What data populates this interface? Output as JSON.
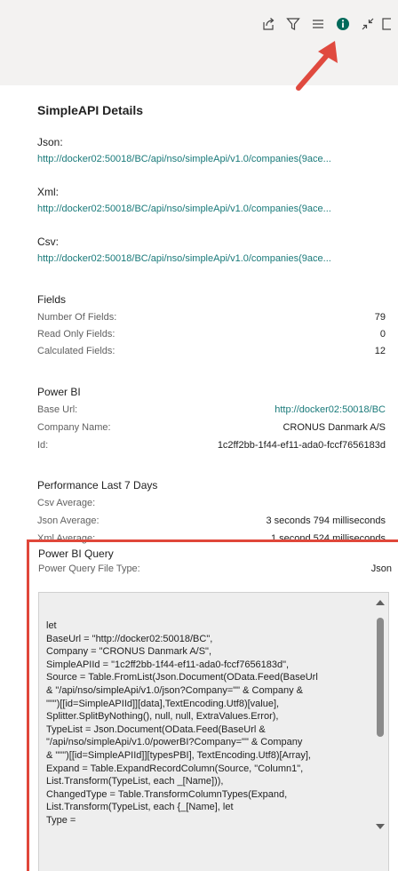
{
  "panel": {
    "title": "SimpleAPI Details"
  },
  "json": {
    "label": "Json:",
    "url": "http://docker02:50018/BC/api/nso/simpleApi/v1.0/companies(9ace..."
  },
  "xml": {
    "label": "Xml:",
    "url": "http://docker02:50018/BC/api/nso/simpleApi/v1.0/companies(9ace..."
  },
  "csv": {
    "label": "Csv:",
    "url": "http://docker02:50018/BC/api/nso/simpleApi/v1.0/companies(9ace..."
  },
  "fields": {
    "title": "Fields",
    "rows": [
      {
        "key": "Number Of Fields:",
        "value": "79"
      },
      {
        "key": "Read Only Fields:",
        "value": "0"
      },
      {
        "key": "Calculated Fields:",
        "value": "12"
      }
    ]
  },
  "powerbi": {
    "title": "Power BI",
    "rows": [
      {
        "key": "Base Url:",
        "value": "http://docker02:50018/BC"
      },
      {
        "key": "Company Name:",
        "value": "CRONUS Danmark A/S"
      },
      {
        "key": "Id:",
        "value": "1c2ff2bb-1f44-ef11-ada0-fccf7656183d"
      }
    ]
  },
  "performance": {
    "title": "Performance Last 7 Days",
    "rows": [
      {
        "key": "Csv Average:",
        "value": ""
      },
      {
        "key": "Json Average:",
        "value": "3 seconds 794 milliseconds"
      },
      {
        "key": "Xml Average:",
        "value": "1 second 524 milliseconds"
      }
    ]
  },
  "query": {
    "title": "Power BI Query",
    "file_type_label": "Power Query File Type:",
    "file_type_value": "Json",
    "code": "let\nBaseUrl = \"http://docker02:50018/BC\",\nCompany = \"CRONUS Danmark A/S\",\nSimpleAPIId = \"1c2ff2bb-1f44-ef11-ada0-fccf7656183d\",\nSource = Table.FromList(Json.Document(OData.Feed(BaseUrl\n& \"/api/nso/simpleApi/v1.0/json?Company=\"\" & Company &\n\"\"\")[[id=SimpleAPIId]][data],TextEncoding.Utf8)[value],\nSplitter.SplitByNothing(), null, null, ExtraValues.Error),\nTypeList = Json.Document(OData.Feed(BaseUrl &\n\"/api/nso/simpleApi/v1.0/powerBI?Company=\"\" & Company\n& \"\"\")[[id=SimpleAPIId]][typesPBI], TextEncoding.Utf8)[Array],\nExpand = Table.ExpandRecordColumn(Source, \"Column1\",\nList.Transform(TypeList, each _[Name])),\nChangedType = Table.TransformColumnTypes(Expand,\nList.Transform(TypeList, each {_[Name], let\nType ="
  },
  "toolbar": {
    "icons": [
      "share-icon",
      "filter-icon",
      "list-icon",
      "info-icon",
      "collapse-icon",
      "expand-icon"
    ]
  },
  "colors": {
    "link": "#1a7a7a",
    "highlight": "#e0473a",
    "accent": "#006a5b"
  }
}
